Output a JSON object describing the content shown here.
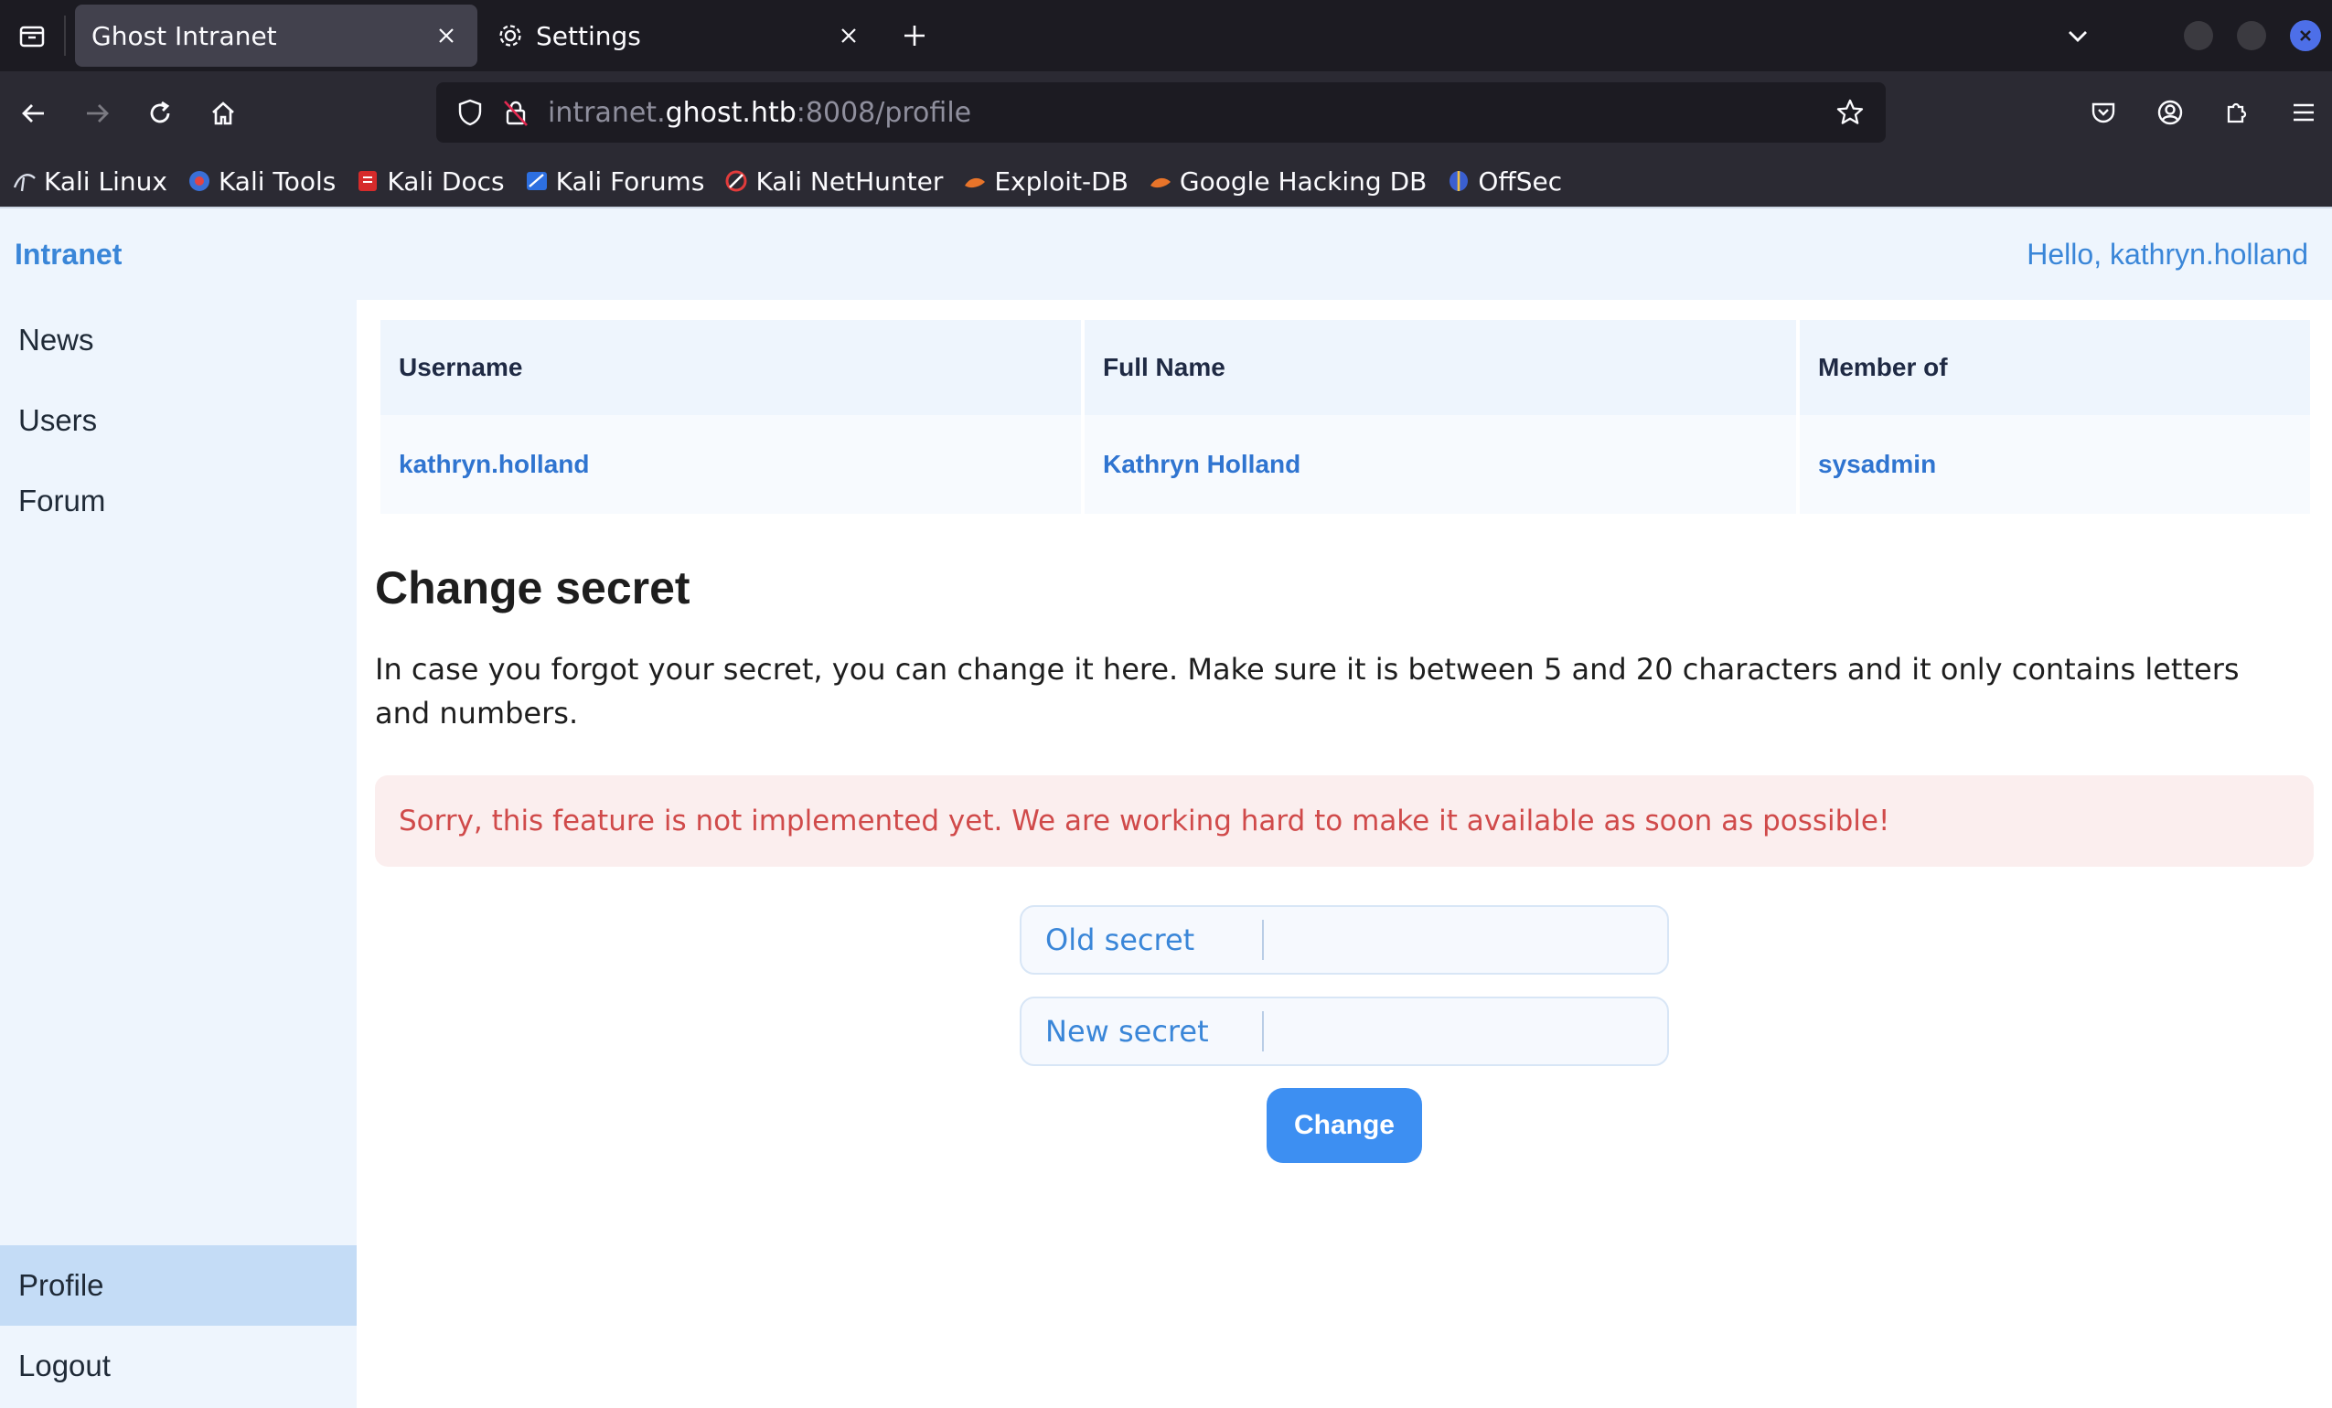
{
  "browser": {
    "tabs": [
      {
        "title": "Ghost Intranet",
        "active": true
      },
      {
        "title": "Settings",
        "active": false,
        "icon": "gear-icon"
      }
    ],
    "url": {
      "prefix": "intranet.",
      "host": "ghost.htb",
      "suffix": ":8008/profile"
    },
    "bookmarks": [
      {
        "label": "Kali Linux",
        "icon": "kali-dragon-icon"
      },
      {
        "label": "Kali Tools",
        "icon": "kali-tools-icon"
      },
      {
        "label": "Kali Docs",
        "icon": "kali-docs-icon"
      },
      {
        "label": "Kali Forums",
        "icon": "kali-forums-icon"
      },
      {
        "label": "Kali NetHunter",
        "icon": "nethunter-icon"
      },
      {
        "label": "Exploit-DB",
        "icon": "exploit-db-icon"
      },
      {
        "label": "Google Hacking DB",
        "icon": "ghdb-icon"
      },
      {
        "label": "OffSec",
        "icon": "offsec-icon"
      }
    ]
  },
  "header": {
    "brand": "Intranet",
    "greeting": "Hello, kathryn.holland"
  },
  "sidebar": {
    "items": [
      {
        "label": "News"
      },
      {
        "label": "Users"
      },
      {
        "label": "Forum"
      },
      {
        "label": "Profile",
        "active": true
      },
      {
        "label": "Logout"
      }
    ]
  },
  "profile_table": {
    "headers": [
      "Username",
      "Full Name",
      "Member of"
    ],
    "row": [
      "kathryn.holland",
      "Kathryn Holland",
      "sysadmin"
    ]
  },
  "change_secret": {
    "title": "Change secret",
    "description": "In case you forgot your secret, you can change it here. Make sure it is between 5 and 20 characters and it only contains letters and numbers.",
    "alert": "Sorry, this feature is not implemented yet. We are working hard to make it available as soon as possible!",
    "old_label": "Old secret",
    "old_value": "",
    "new_label": "New secret",
    "new_value": "",
    "button": "Change"
  },
  "colors": {
    "accent": "#3a86d8",
    "button": "#3d8ff2",
    "alert_text": "#d04a4a",
    "alert_bg": "#fbeeee",
    "sidebar_bg": "#eef5fd",
    "sidebar_active": "#c4dcf6"
  }
}
